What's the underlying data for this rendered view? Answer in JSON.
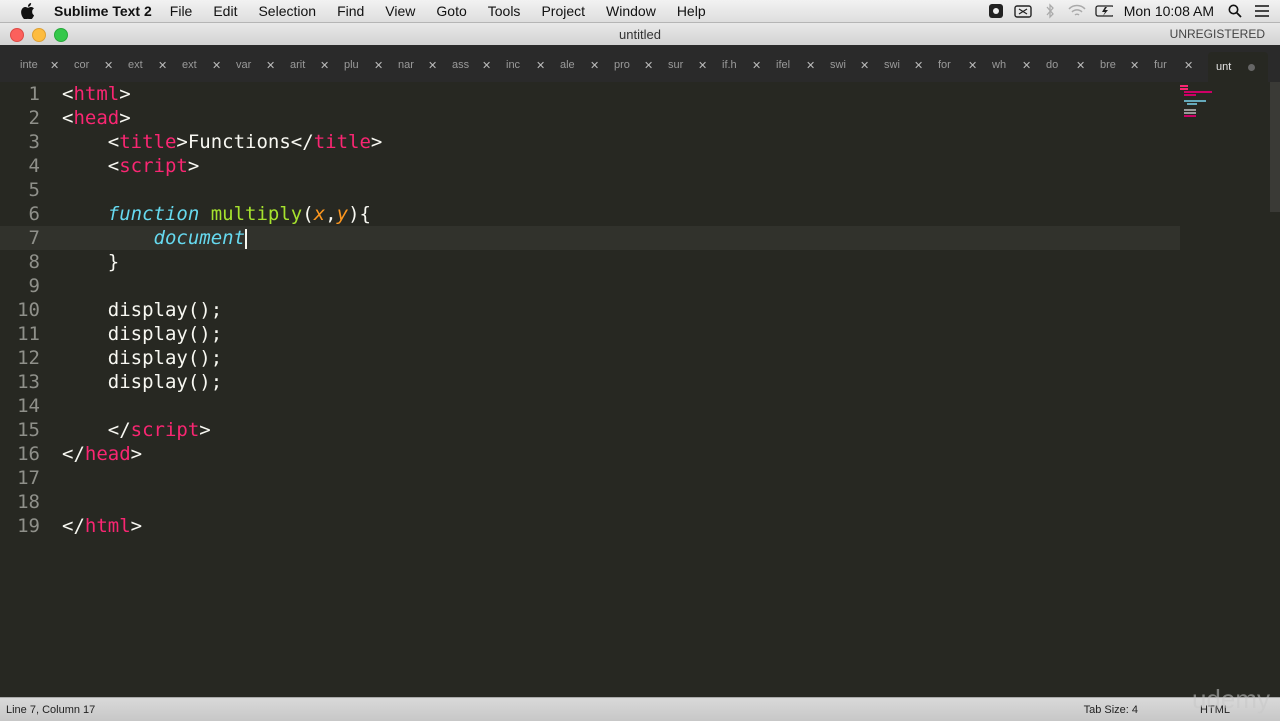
{
  "menubar": {
    "app_name": "Sublime Text 2",
    "items": [
      "File",
      "Edit",
      "Selection",
      "Find",
      "View",
      "Goto",
      "Tools",
      "Project",
      "Window",
      "Help"
    ],
    "clock": "Mon 10:08 AM"
  },
  "window": {
    "title": "untitled",
    "registration": "UNREGISTERED"
  },
  "tabs": [
    {
      "label": "inte"
    },
    {
      "label": "cor"
    },
    {
      "label": "ext"
    },
    {
      "label": "ext"
    },
    {
      "label": "var"
    },
    {
      "label": "arit"
    },
    {
      "label": "plu"
    },
    {
      "label": "nar"
    },
    {
      "label": "ass"
    },
    {
      "label": "inc"
    },
    {
      "label": "ale"
    },
    {
      "label": "pro"
    },
    {
      "label": "sur"
    },
    {
      "label": "if.h"
    },
    {
      "label": "ifel"
    },
    {
      "label": "swi"
    },
    {
      "label": "swi"
    },
    {
      "label": "for"
    },
    {
      "label": "wh"
    },
    {
      "label": "do"
    },
    {
      "label": "bre"
    },
    {
      "label": "fur"
    },
    {
      "label": "unt",
      "active": true
    }
  ],
  "editor": {
    "lines": [
      {
        "n": "1",
        "parts": [
          [
            "p",
            "<"
          ],
          [
            "tag",
            "html"
          ],
          [
            "p",
            ">"
          ]
        ]
      },
      {
        "n": "2",
        "parts": [
          [
            "p",
            "<"
          ],
          [
            "tag",
            "head"
          ],
          [
            "p",
            ">"
          ]
        ]
      },
      {
        "n": "3",
        "parts": [
          [
            "p",
            "    <"
          ],
          [
            "tag",
            "title"
          ],
          [
            "p",
            ">Functions</"
          ],
          [
            "tag",
            "title"
          ],
          [
            "p",
            ">"
          ]
        ]
      },
      {
        "n": "4",
        "parts": [
          [
            "p",
            "    <"
          ],
          [
            "tag",
            "script"
          ],
          [
            "p",
            ">"
          ]
        ]
      },
      {
        "n": "5",
        "parts": []
      },
      {
        "n": "6",
        "parts": [
          [
            "p",
            "    "
          ],
          [
            "kw",
            "function"
          ],
          [
            "p",
            " "
          ],
          [
            "fn",
            "multiply"
          ],
          [
            "p",
            "("
          ],
          [
            "param",
            "x"
          ],
          [
            "p",
            ","
          ],
          [
            "param",
            "y"
          ],
          [
            "p",
            "){"
          ]
        ]
      },
      {
        "n": "7",
        "parts": [
          [
            "p",
            "        "
          ],
          [
            "kw",
            "document"
          ]
        ],
        "current": true,
        "cursor": true
      },
      {
        "n": "8",
        "parts": [
          [
            "p",
            "    }"
          ]
        ]
      },
      {
        "n": "9",
        "parts": []
      },
      {
        "n": "10",
        "parts": [
          [
            "p",
            "    display();"
          ]
        ]
      },
      {
        "n": "11",
        "parts": [
          [
            "p",
            "    display();"
          ]
        ]
      },
      {
        "n": "12",
        "parts": [
          [
            "p",
            "    display();"
          ]
        ]
      },
      {
        "n": "13",
        "parts": [
          [
            "p",
            "    display();"
          ]
        ]
      },
      {
        "n": "14",
        "parts": []
      },
      {
        "n": "15",
        "parts": [
          [
            "p",
            "    </"
          ],
          [
            "tag",
            "script"
          ],
          [
            "p",
            ">"
          ]
        ]
      },
      {
        "n": "16",
        "parts": [
          [
            "p",
            "</"
          ],
          [
            "tag",
            "head"
          ],
          [
            "p",
            ">"
          ]
        ]
      },
      {
        "n": "17",
        "parts": []
      },
      {
        "n": "18",
        "parts": []
      },
      {
        "n": "19",
        "parts": [
          [
            "p",
            "</"
          ],
          [
            "tag",
            "html"
          ],
          [
            "p",
            ">"
          ]
        ]
      }
    ]
  },
  "statusbar": {
    "position": "Line 7, Column 17",
    "tab_size": "Tab Size: 4",
    "syntax": "HTML"
  },
  "watermark": "udemy",
  "colors": {
    "background": "#272822",
    "tag": "#f92672",
    "keyword": "#66d9ef",
    "function_name": "#a6e22e",
    "parameter": "#fd971f",
    "text": "#f8f8f2"
  }
}
